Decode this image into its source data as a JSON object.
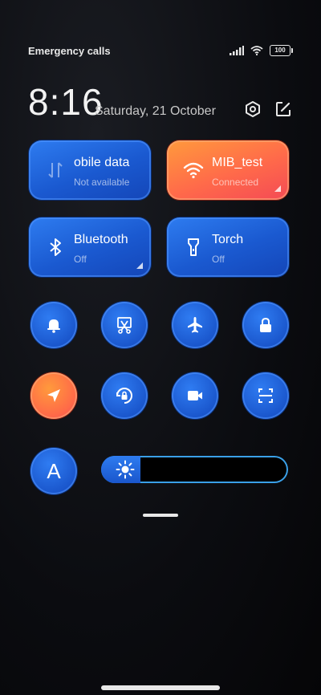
{
  "status": {
    "left_text": "Emergency calls o",
    "battery": "100"
  },
  "header": {
    "time": "8:16",
    "date": "Saturday, 21 October"
  },
  "tiles": [
    {
      "label": "obile data",
      "sub": "Not available",
      "icon": "mobile-data-icon"
    },
    {
      "label": "MIB_test",
      "sub": "Connected",
      "icon": "wifi-icon"
    },
    {
      "label": "Bluetooth",
      "sub": "Off",
      "icon": "bluetooth-icon"
    },
    {
      "label": "Torch",
      "sub": "Off",
      "icon": "torch-icon"
    }
  ],
  "round_buttons": [
    {
      "icon": "bell-icon"
    },
    {
      "icon": "screenshot-scissors-icon"
    },
    {
      "icon": "airplane-icon"
    },
    {
      "icon": "lock-icon"
    },
    {
      "icon": "location-icon"
    },
    {
      "icon": "rotation-lock-icon"
    },
    {
      "icon": "video-camera-icon"
    },
    {
      "icon": "scan-icon"
    }
  ],
  "font_button": {
    "label": "A"
  },
  "brightness": {
    "level": 0.21,
    "icon": "sun-icon"
  },
  "colors": {
    "tile_blue": "#1a59d0",
    "tile_orange": "#ff6a4a",
    "slider_border": "#3aa0e8"
  }
}
